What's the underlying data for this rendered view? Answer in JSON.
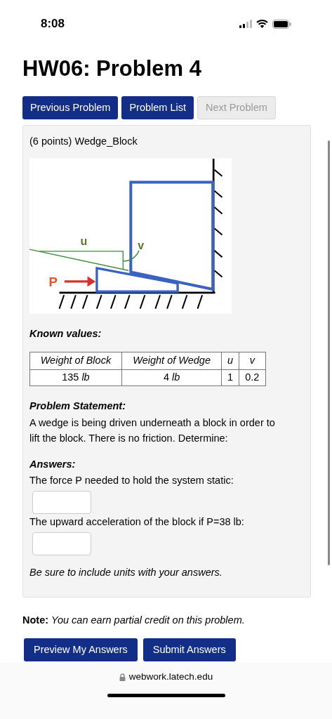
{
  "status_bar": {
    "time": "8:08"
  },
  "title": "HW06: Problem 4",
  "nav_buttons": [
    {
      "label": "Previous Problem",
      "disabled": false
    },
    {
      "label": "Problem List",
      "disabled": false
    },
    {
      "label": "Next Problem",
      "disabled": true
    }
  ],
  "problem": {
    "header": "(6 points) Wedge_Block",
    "diagram_labels": {
      "u": "u",
      "v": "v",
      "p": "P"
    },
    "known_values_heading": "Known values:",
    "table": {
      "columns": [
        "Weight of Block",
        "Weight of Wedge",
        "u",
        "v"
      ],
      "rows": [
        [
          "135 *lb*",
          "4 *lb*",
          "1",
          "0.2"
        ]
      ]
    },
    "statement_heading": "Problem Statement:",
    "statement": "A wedge is being driven underneath a block in order to lift the block. There is no friction. Determine:",
    "answers_heading": "Answers:",
    "questions": [
      {
        "label": "The force P needed to hold the system static:"
      },
      {
        "label": "The upward acceleration of the block if P=38 lb:"
      }
    ],
    "units_note": "Be sure to include units with your answers."
  },
  "note": {
    "label": "Note:",
    "text": "You can earn partial credit on this problem."
  },
  "action_buttons": [
    "Preview My Answers",
    "Submit Answers"
  ],
  "url": "webwork.latech.edu"
}
